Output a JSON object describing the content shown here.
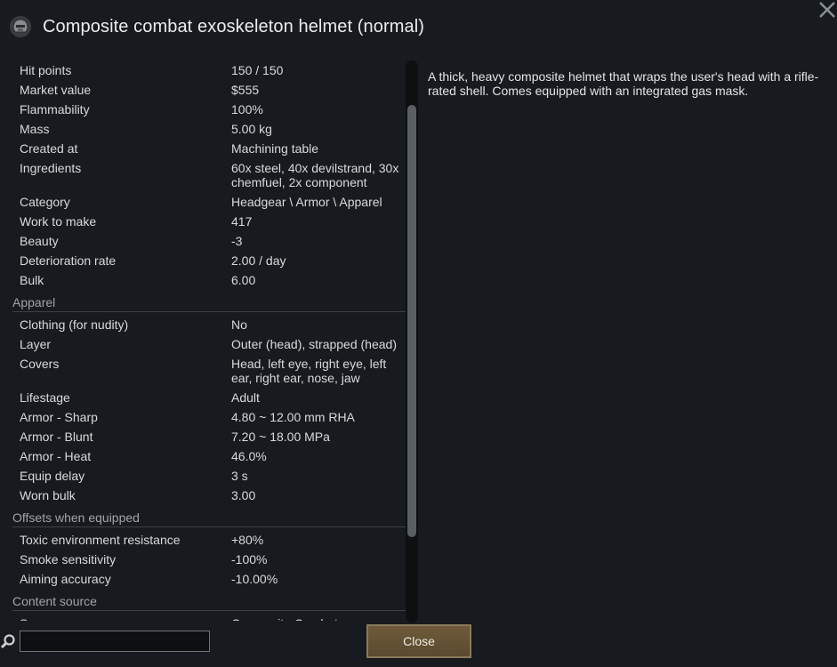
{
  "window": {
    "title": "Composite combat exoskeleton helmet (normal)"
  },
  "stats": {
    "general": [
      {
        "label": "Hit points",
        "value": "150 / 150"
      },
      {
        "label": "Market value",
        "value": "$555"
      },
      {
        "label": "Flammability",
        "value": "100%"
      },
      {
        "label": "Mass",
        "value": "5.00 kg"
      },
      {
        "label": "Created at",
        "value": "Machining table"
      },
      {
        "label": "Ingredients",
        "value": "60x steel, 40x devilstrand, 30x chemfuel, 2x component"
      },
      {
        "label": "Category",
        "value": "Headgear \\ Armor \\ Apparel"
      },
      {
        "label": "Work to make",
        "value": "417"
      },
      {
        "label": "Beauty",
        "value": "-3"
      },
      {
        "label": "Deterioration rate",
        "value": "2.00 / day"
      },
      {
        "label": "Bulk",
        "value": "6.00"
      }
    ],
    "apparel_header": "Apparel",
    "apparel": [
      {
        "label": "Clothing (for nudity)",
        "value": "No"
      },
      {
        "label": "Layer",
        "value": "Outer (head), strapped (head)"
      },
      {
        "label": "Covers",
        "value": "Head, left eye, right eye, left ear, right ear, nose, jaw"
      },
      {
        "label": "Lifestage",
        "value": "Adult"
      },
      {
        "label": "Armor - Sharp",
        "value": "4.80 ~ 12.00 mm RHA"
      },
      {
        "label": "Armor - Blunt",
        "value": "7.20 ~ 18.00 MPa"
      },
      {
        "label": "Armor - Heat",
        "value": "46.0%"
      },
      {
        "label": "Equip delay",
        "value": "3 s"
      },
      {
        "label": "Worn bulk",
        "value": "3.00"
      }
    ],
    "offsets_header": "Offsets when equipped",
    "offsets": [
      {
        "label": "Toxic environment resistance",
        "value": "+80%"
      },
      {
        "label": "Smoke sensitivity",
        "value": "-100%"
      },
      {
        "label": "Aiming accuracy",
        "value": "-10.00%"
      }
    ],
    "content_header": "Content source",
    "content": [
      {
        "label": "Source",
        "value": "Composite Combat"
      }
    ]
  },
  "description": "A thick, heavy composite helmet that wraps the user's head with a rifle-rated shell. Comes equipped with an integrated gas mask.",
  "search": {
    "value": "",
    "placeholder": ""
  },
  "buttons": {
    "close_label": "Close"
  },
  "icons": {
    "close": "close-x-icon",
    "item": "helmet-icon",
    "search": "magnifier-icon"
  },
  "colors": {
    "background": "#171b1f",
    "button": "#5f4e32",
    "text": "#d9d9d9"
  }
}
